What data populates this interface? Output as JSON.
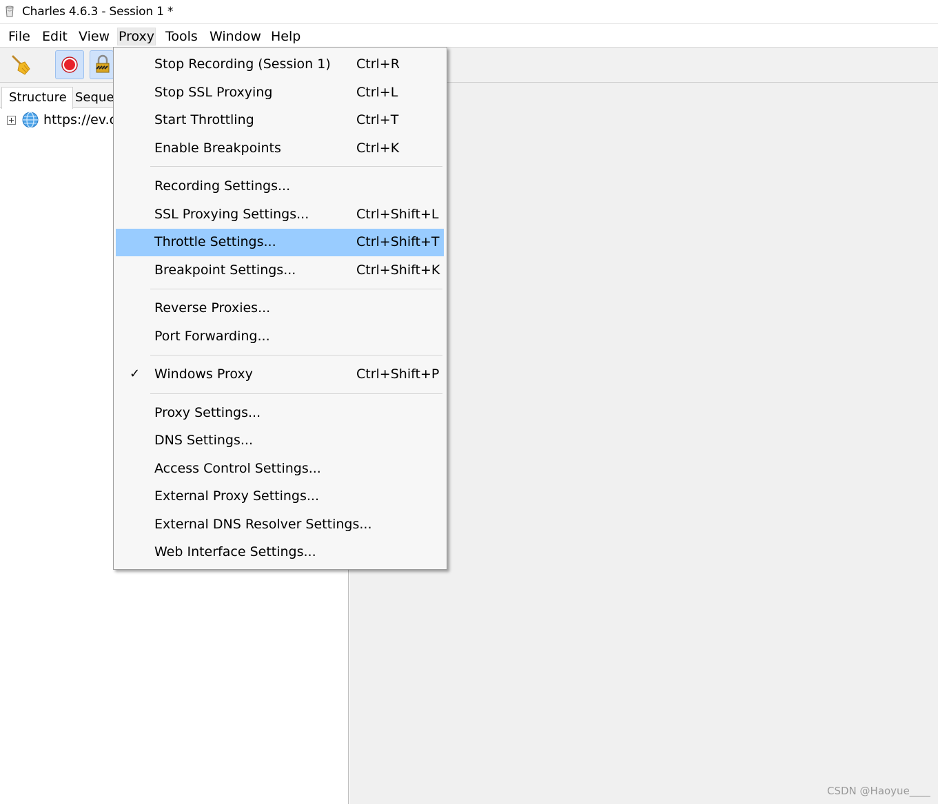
{
  "window": {
    "title": "Charles 4.6.3 - Session 1 *"
  },
  "menubar": {
    "items": [
      "File",
      "Edit",
      "View",
      "Proxy",
      "Tools",
      "Window",
      "Help"
    ],
    "active": "Proxy"
  },
  "toolbar": {
    "buttons": [
      {
        "icon": "broom-icon"
      },
      {
        "icon": "record-icon",
        "pressed": true,
        "color": "#e8212b"
      },
      {
        "icon": "lock-icon",
        "pressed": true
      }
    ]
  },
  "left_pane": {
    "tabs": [
      "Structure",
      "Seque"
    ],
    "selected_tab": "Structure",
    "tree": [
      {
        "label": "https://ev.cs",
        "icon": "globe-icon"
      }
    ]
  },
  "proxy_menu": {
    "groups": [
      [
        {
          "label": "Stop Recording (Session 1)",
          "shortcut": "Ctrl+R"
        },
        {
          "label": "Stop SSL Proxying",
          "shortcut": "Ctrl+L"
        },
        {
          "label": "Start Throttling",
          "shortcut": "Ctrl+T"
        },
        {
          "label": "Enable Breakpoints",
          "shortcut": "Ctrl+K"
        }
      ],
      [
        {
          "label": "Recording Settings...",
          "shortcut": ""
        },
        {
          "label": "SSL Proxying Settings...",
          "shortcut": "Ctrl+Shift+L"
        },
        {
          "label": "Throttle Settings...",
          "shortcut": "Ctrl+Shift+T",
          "highlighted": true
        },
        {
          "label": "Breakpoint Settings...",
          "shortcut": "Ctrl+Shift+K"
        }
      ],
      [
        {
          "label": "Reverse Proxies...",
          "shortcut": ""
        },
        {
          "label": "Port Forwarding...",
          "shortcut": ""
        }
      ],
      [
        {
          "label": "Windows Proxy",
          "shortcut": "Ctrl+Shift+P",
          "checked": true,
          "check_glyph": "✓"
        }
      ],
      [
        {
          "label": "Proxy Settings...",
          "shortcut": ""
        },
        {
          "label": "DNS Settings...",
          "shortcut": ""
        },
        {
          "label": "Access Control Settings...",
          "shortcut": ""
        },
        {
          "label": "External Proxy Settings...",
          "shortcut": ""
        },
        {
          "label": "External DNS Resolver Settings...",
          "shortcut": ""
        },
        {
          "label": "Web Interface Settings...",
          "shortcut": ""
        }
      ]
    ],
    "highlight_color": "#99ccff"
  },
  "watermark": "CSDN @Haoyue____"
}
